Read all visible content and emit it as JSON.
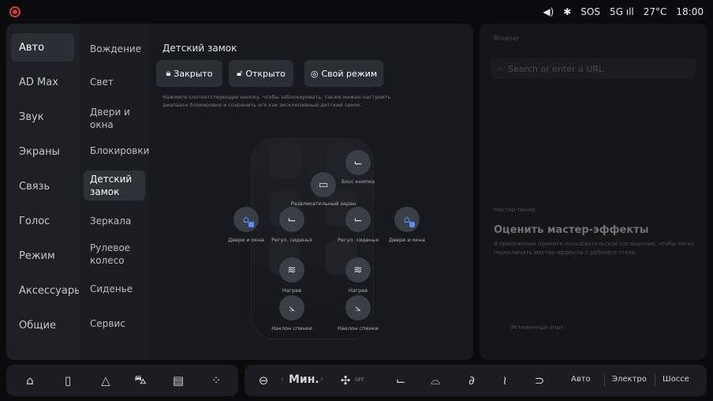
{
  "status": {
    "sos": "SOS",
    "network": "5G",
    "temperature": "27°C",
    "time": "18:00"
  },
  "nav": [
    {
      "label": "Авто"
    },
    {
      "label": "AD Max"
    },
    {
      "label": "Звук"
    },
    {
      "label": "Экраны"
    },
    {
      "label": "Связь"
    },
    {
      "label": "Голос"
    },
    {
      "label": "Режим"
    },
    {
      "label": "Аксессуары"
    },
    {
      "label": "Общие"
    }
  ],
  "subnav": [
    {
      "label": "Вождение"
    },
    {
      "label": "Свет"
    },
    {
      "label": "Двери и окна"
    },
    {
      "label": "Блокировки"
    },
    {
      "label": "Детский замок"
    },
    {
      "label": "Зеркала"
    },
    {
      "label": "Рулевое колесо"
    },
    {
      "label": "Сиденье"
    },
    {
      "label": "Сервис"
    }
  ],
  "content": {
    "title": "Детский замок",
    "buttons": {
      "closed": "Закрыто",
      "open": "Открыто",
      "custom": "Свой режим"
    },
    "hint": "Нажмите соответствующую кнопку, чтобы заблокировать, также можно настроить диапазон блокировки и сохранить его как эксклюзивный детский замок.",
    "car": {
      "boss_button": "Босс кнопка",
      "entertainment_screen": "Развлекательный экран",
      "doors_windows_left": "Двери и окна",
      "doors_windows_right": "Двери и окна",
      "seat_adjust_left": "Регул. сиденья",
      "seat_adjust_right": "Регул. сиденья",
      "heating_left": "Нагрев",
      "heating_right": "Нагрев",
      "recline_left": "Наклон спинки",
      "recline_right": "Наклон спинки"
    }
  },
  "right_panel": {
    "browser_label": "Browser",
    "search_placeholder": "Search or enter a URL",
    "master_label": "Мастер-тюнер",
    "master_title": "Оценить мастер-эффекты",
    "master_desc": "В приложении примите пользовательское соглашение, чтобы легко переключать мастер-эффекты с рабочего стола.",
    "instant_label": "Мгновенный опыт"
  },
  "dock": {
    "fan_level": "Мин.",
    "fan_state": "OFF",
    "modes": [
      "Авто",
      "Электро",
      "Шоссе"
    ]
  },
  "colors": {
    "accent_blue": "#5b8dff",
    "alert_red": "#d63a3a"
  }
}
